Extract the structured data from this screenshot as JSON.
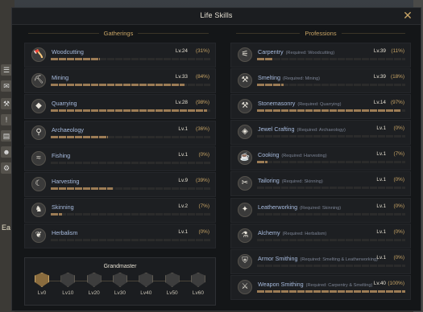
{
  "window": {
    "title": "Life Skills"
  },
  "sections": {
    "gatherings": "Gatherings",
    "professions": "Professions"
  },
  "colors": {
    "accent": "#c9a566",
    "bar_fill": "#9c7c55",
    "skill_name": "#a9bde0"
  },
  "hud": {
    "left_text": "Ea"
  },
  "gatherings": [
    {
      "name": "Woodcutting",
      "level": "Lv.24",
      "percent": "(31%)",
      "progress": 0.31,
      "icon": "axe-icon"
    },
    {
      "name": "Mining",
      "level": "Lv.33",
      "percent": "(84%)",
      "progress": 0.84,
      "icon": "pickaxe-icon"
    },
    {
      "name": "Quarrying",
      "level": "Lv.28",
      "percent": "(98%)",
      "progress": 0.98,
      "icon": "stone-icon"
    },
    {
      "name": "Archaeology",
      "level": "Lv.1",
      "percent": "(36%)",
      "progress": 0.36,
      "icon": "shovel-icon"
    },
    {
      "name": "Fishing",
      "level": "Lv.1",
      "percent": "(0%)",
      "progress": 0.0,
      "icon": "fish-icon"
    },
    {
      "name": "Harvesting",
      "level": "Lv.9",
      "percent": "(39%)",
      "progress": 0.39,
      "icon": "sickle-icon"
    },
    {
      "name": "Skinning",
      "level": "Lv.2",
      "percent": "(7%)",
      "progress": 0.07,
      "icon": "beast-icon"
    },
    {
      "name": "Herbalism",
      "level": "Lv.1",
      "percent": "(0%)",
      "progress": 0.0,
      "icon": "herb-icon"
    }
  ],
  "professions": [
    {
      "name": "Carpentry",
      "req": "(Required: Woodcutting)",
      "level": "Lv.39",
      "percent": "(11%)",
      "progress": 0.11,
      "icon": "saw-icon"
    },
    {
      "name": "Smelting",
      "req": "(Required: Mining)",
      "level": "Lv.39",
      "percent": "(18%)",
      "progress": 0.18,
      "icon": "anvil-icon"
    },
    {
      "name": "Stonemasonry",
      "req": "(Required: Quarrying)",
      "level": "Lv.14",
      "percent": "(97%)",
      "progress": 0.97,
      "icon": "hammer-icon"
    },
    {
      "name": "Jewel Crafting",
      "req": "(Required: Archaeology)",
      "level": "Lv.1",
      "percent": "(0%)",
      "progress": 0.0,
      "icon": "gem-icon"
    },
    {
      "name": "Cooking",
      "req": "(Required: Harvesting)",
      "level": "Lv.1",
      "percent": "(7%)",
      "progress": 0.07,
      "icon": "pot-icon"
    },
    {
      "name": "Tailoring",
      "req": "(Required: Skinning)",
      "level": "Lv.1",
      "percent": "(0%)",
      "progress": 0.0,
      "icon": "scissors-icon"
    },
    {
      "name": "Leatherworking",
      "req": "(Required: Skinning)",
      "level": "Lv.1",
      "percent": "(0%)",
      "progress": 0.0,
      "icon": "leather-icon"
    },
    {
      "name": "Alchemy",
      "req": "(Required: Herbalism)",
      "level": "Lv.1",
      "percent": "(0%)",
      "progress": 0.0,
      "icon": "flask-icon"
    },
    {
      "name": "Armor Smithing",
      "req": "(Required: Smelting & Leatherworking)",
      "level": "Lv.1",
      "percent": "(0%)",
      "progress": 0.0,
      "icon": "armor-icon"
    },
    {
      "name": "Weapon Smithing",
      "req": "(Required: Carpentry & Smelting)",
      "level": "Lv.40",
      "percent": "(100%)",
      "progress": 1.0,
      "icon": "sword-icon"
    }
  ],
  "grandmaster": {
    "title": "Grandmaster",
    "levels": [
      "Lv0",
      "Lv10",
      "Lv20",
      "Lv30",
      "Lv40",
      "Lv50",
      "Lv60"
    ],
    "active_index": 0
  }
}
